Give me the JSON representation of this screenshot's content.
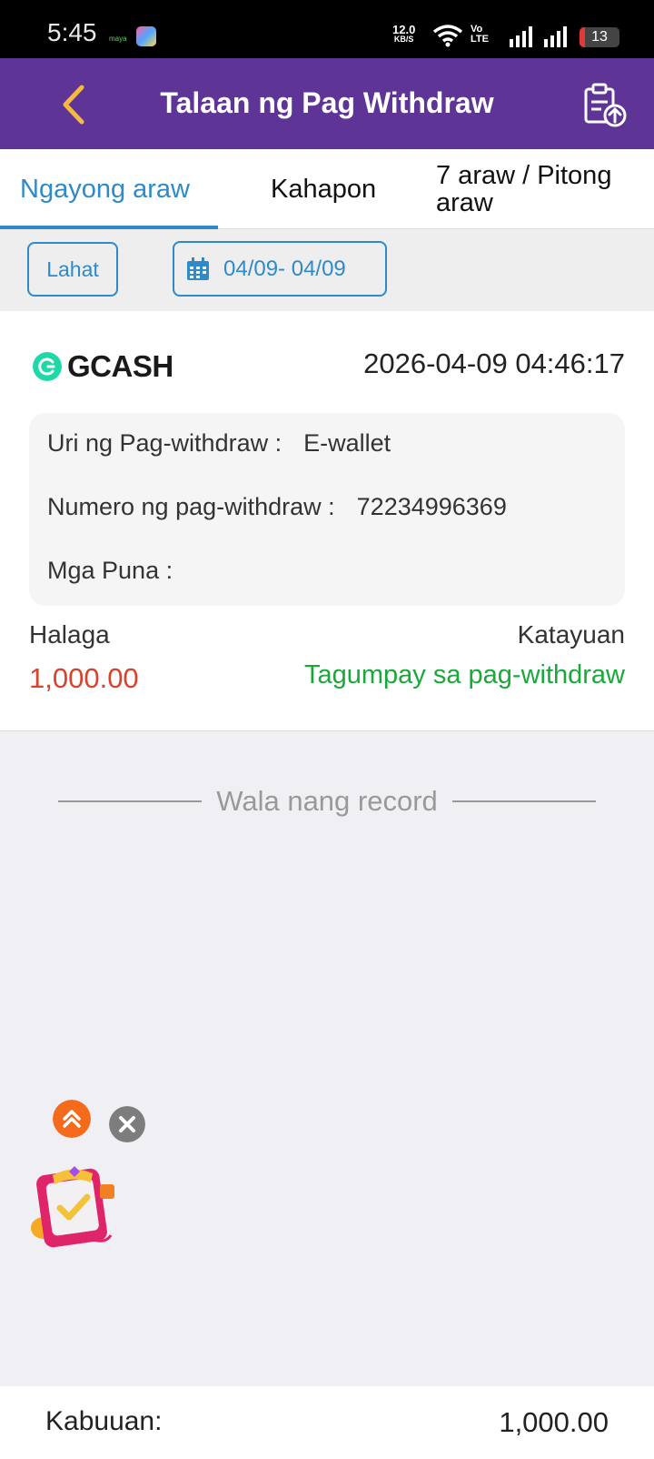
{
  "status_bar": {
    "time": "5:45",
    "app_icon_label": "maya",
    "net_speed_value": "12.0",
    "net_speed_unit": "KB/S",
    "volte_top": "Vo",
    "volte_bottom": "LTE",
    "battery_level": "13"
  },
  "header": {
    "title": "Talaan ng Pag Withdraw"
  },
  "tabs": [
    {
      "label": "Ngayong araw",
      "active": true
    },
    {
      "label": "Kahapon",
      "active": false
    },
    {
      "label": "7 araw / Pitong araw",
      "active": false
    }
  ],
  "filter": {
    "all_label": "Lahat",
    "date_range": "04/09- 04/09"
  },
  "record": {
    "provider": "GCASH",
    "datetime": "2026-04-09 04:46:17",
    "details": [
      {
        "label": "Uri ng Pag-withdraw :",
        "value": "E-wallet"
      },
      {
        "label": "Numero ng pag-withdraw :",
        "value": "72234996369"
      },
      {
        "label": "Mga Puna :",
        "value": ""
      }
    ],
    "amount_label": "Halaga",
    "amount": "1,000.00",
    "status_label": "Katayuan",
    "status": "Tagumpay sa pag-withdraw"
  },
  "no_more_text": "Wala nang record",
  "footer": {
    "total_label": "Kabuuan:",
    "total_value": "1,000.00"
  },
  "colors": {
    "header_bg": "#5e3596",
    "accent": "#2e8ac9",
    "back_arrow": "#f5b942",
    "amount": "#d9422d",
    "success": "#1aa83b"
  },
  "icons": [
    "back-arrow-icon",
    "clipboard-upload-icon",
    "calendar-icon",
    "gcash-logo-icon",
    "double-chevron-up-icon",
    "close-icon",
    "gift-checklist-icon"
  ]
}
